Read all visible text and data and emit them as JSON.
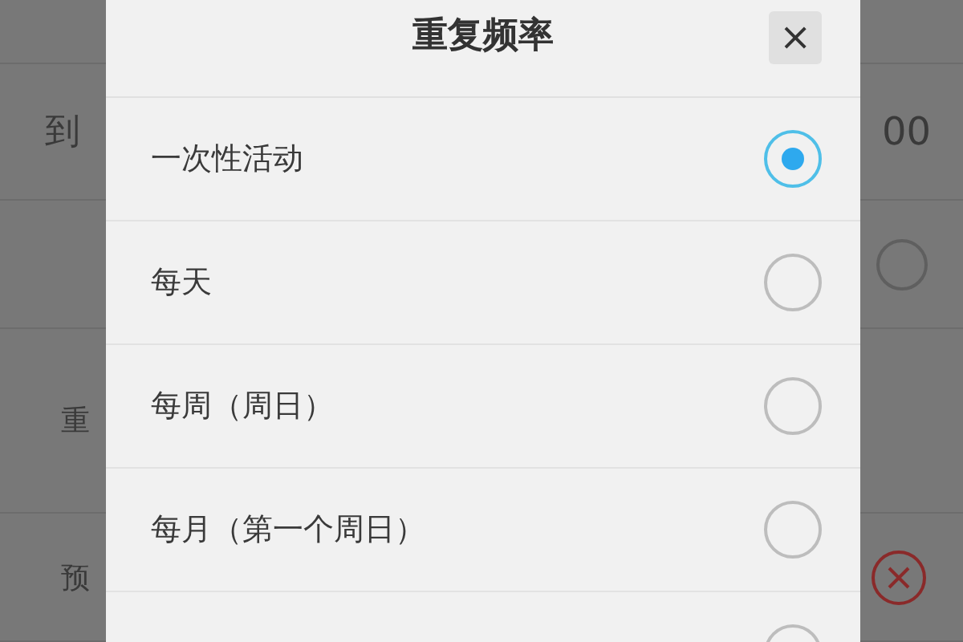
{
  "background": {
    "rows": [
      {
        "kind": "blank"
      },
      {
        "label": "到",
        "value": "00",
        "kind": "time"
      },
      {
        "kind": "radio",
        "selected": false
      },
      {
        "label": "重",
        "kind": "text"
      },
      {
        "label": "预",
        "kind": "remove"
      }
    ]
  },
  "dialog": {
    "title": "重复频率",
    "close": "×",
    "options": [
      {
        "label": "一次性活动",
        "selected": true
      },
      {
        "label": "每天",
        "selected": false
      },
      {
        "label": "每周（周日）",
        "selected": false
      },
      {
        "label": "每月（第一个周日）",
        "selected": false
      },
      {
        "selected": false
      }
    ]
  }
}
